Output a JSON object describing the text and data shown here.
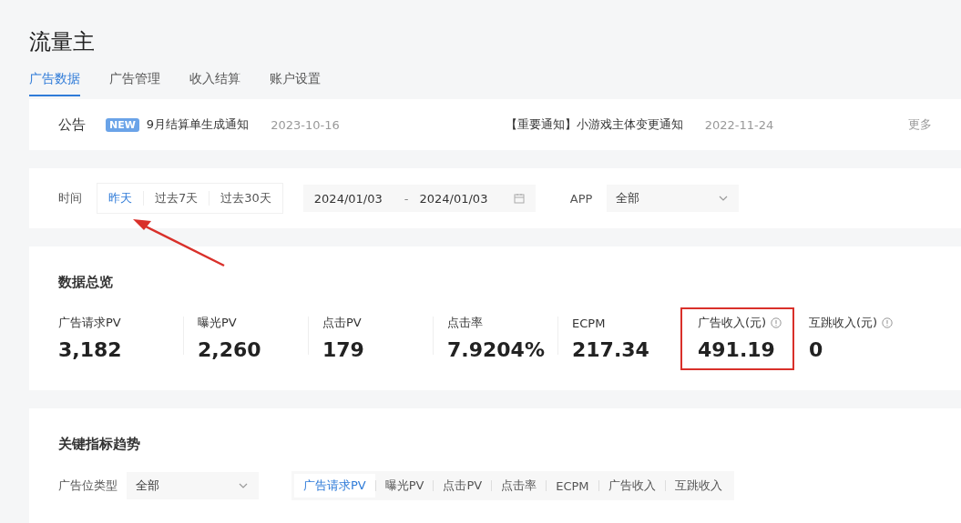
{
  "title": "流量主",
  "tabs": [
    {
      "label": "广告数据",
      "selected": true
    },
    {
      "label": "广告管理",
      "selected": false
    },
    {
      "label": "收入结算",
      "selected": false
    },
    {
      "label": "账户设置",
      "selected": false
    }
  ],
  "notice": {
    "label": "公告",
    "items": [
      {
        "badge": "NEW",
        "text": "9月结算单生成通知",
        "date": "2023-10-16"
      },
      {
        "text": "【重要通知】小游戏主体变更通知",
        "date": "2022-11-24"
      }
    ],
    "more": "更多"
  },
  "filters": {
    "time_label": "时间",
    "ranges": [
      {
        "label": "昨天",
        "selected": true
      },
      {
        "label": "过去7天",
        "selected": false
      },
      {
        "label": "过去30天",
        "selected": false
      }
    ],
    "start": "2024/01/03",
    "separator": "-",
    "end": "2024/01/03",
    "app_label": "APP",
    "app_value": "全部"
  },
  "overview": {
    "title": "数据总览",
    "metrics": [
      {
        "label": "广告请求PV",
        "value": "3,182",
        "info": false,
        "highlighted": false
      },
      {
        "label": "曝光PV",
        "value": "2,260",
        "info": false,
        "highlighted": false
      },
      {
        "label": "点击PV",
        "value": "179",
        "info": false,
        "highlighted": false
      },
      {
        "label": "点击率",
        "value": "7.9204%",
        "info": false,
        "highlighted": false
      },
      {
        "label": "ECPM",
        "value": "217.34",
        "info": false,
        "highlighted": false
      },
      {
        "label": "广告收入(元)",
        "value": "491.19",
        "info": true,
        "highlighted": true
      },
      {
        "label": "互跳收入(元)",
        "value": "0",
        "info": true,
        "highlighted": false
      }
    ]
  },
  "trend": {
    "title": "关键指标趋势",
    "slot_label": "广告位类型",
    "slot_value": "全部",
    "metric_tabs": [
      {
        "label": "广告请求PV",
        "selected": true
      },
      {
        "label": "曝光PV",
        "selected": false
      },
      {
        "label": "点击PV",
        "selected": false
      },
      {
        "label": "点击率",
        "selected": false
      },
      {
        "label": "ECPM",
        "selected": false
      },
      {
        "label": "广告收入",
        "selected": false
      },
      {
        "label": "互跳收入",
        "selected": false
      }
    ]
  }
}
